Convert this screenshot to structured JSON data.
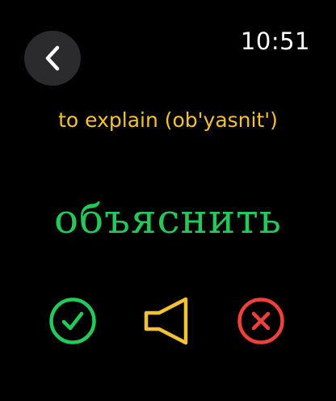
{
  "status": {
    "time": "10:51"
  },
  "card": {
    "translation": "to explain (ob'yasnit')",
    "word": "объяснить"
  },
  "actions": {
    "correct_icon": "checkmark-circle-icon",
    "audio_icon": "speaker-icon",
    "wrong_icon": "x-circle-icon"
  },
  "colors": {
    "background": "#000000",
    "translation": "#f2c230",
    "word": "#24c95a",
    "correct": "#24c95a",
    "audio": "#f2c230",
    "wrong": "#f0403a",
    "back_button_bg": "#2b2b2e"
  }
}
